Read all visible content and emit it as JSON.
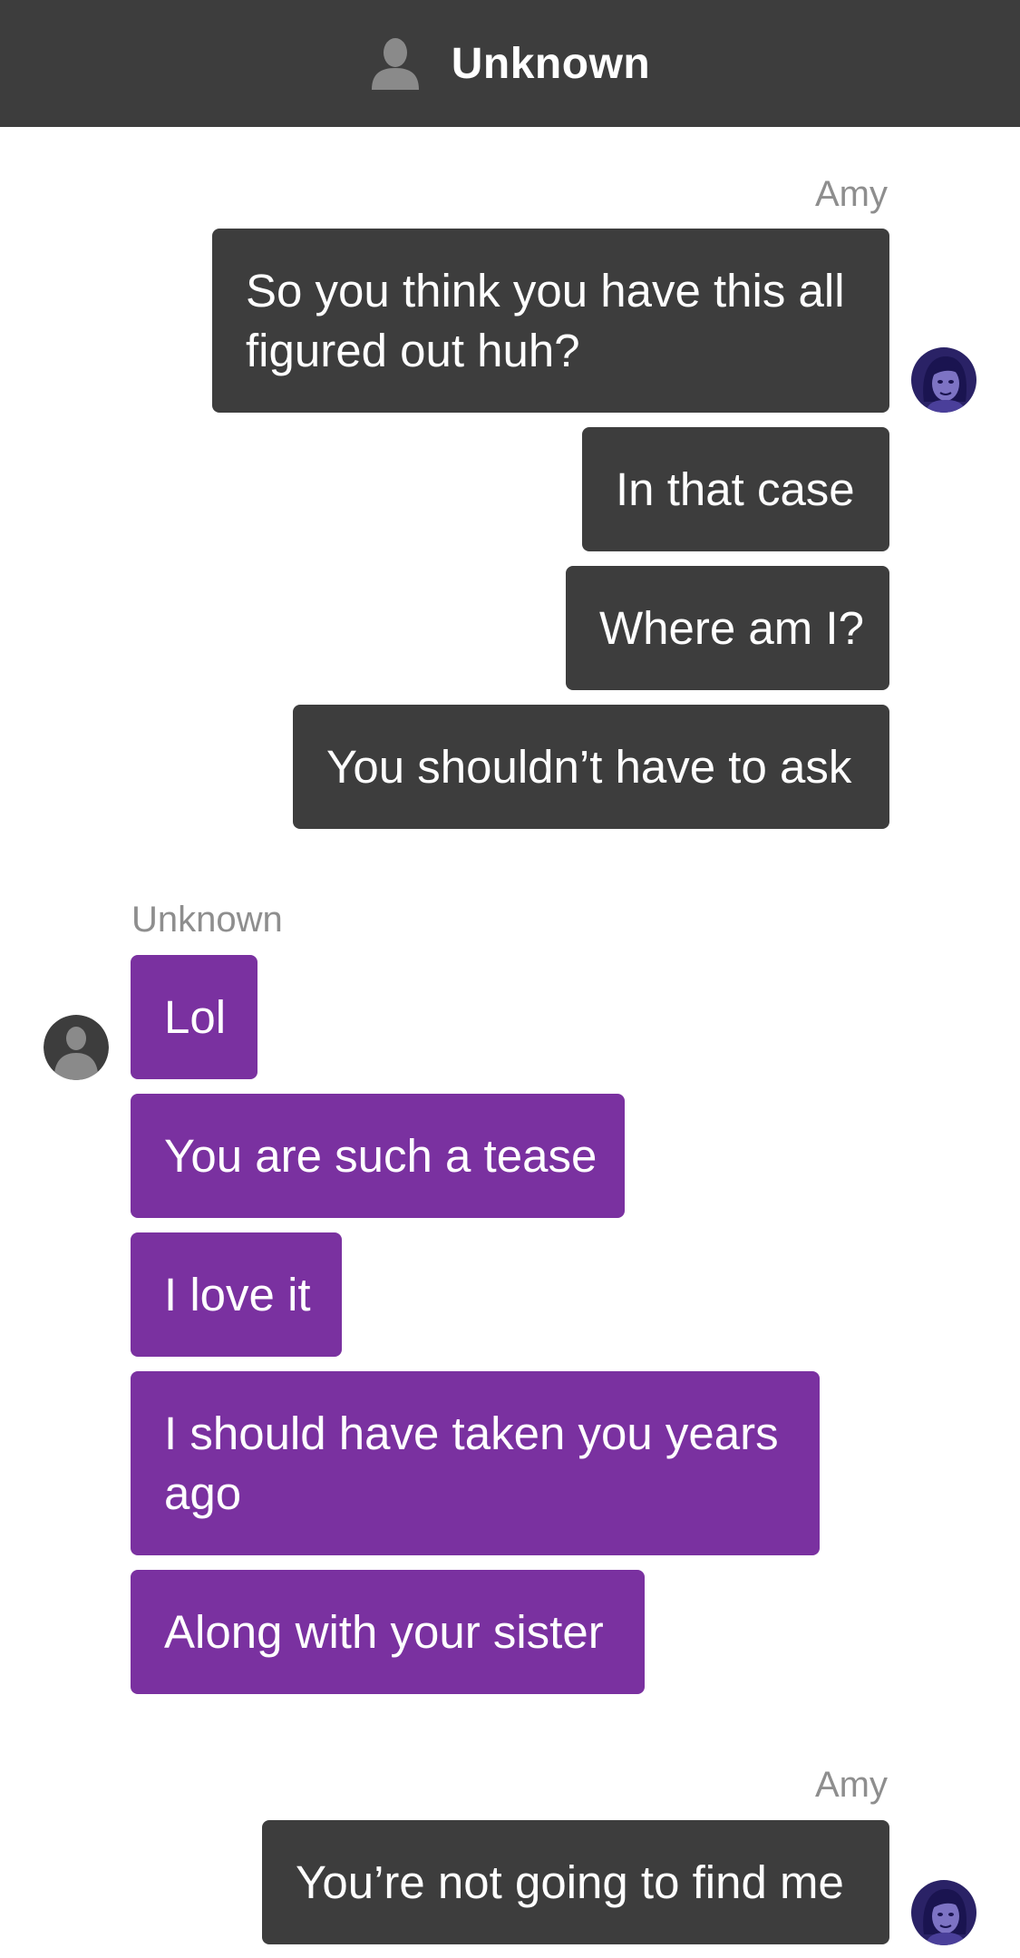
{
  "header": {
    "title": "Unknown",
    "avatar_icon": "person-silhouette-icon"
  },
  "conversation": {
    "groups": [
      {
        "sender": "Amy",
        "messages": [
          "So you think you have this all\nfigured out huh?",
          "In that case",
          "Where am I?",
          "You shouldn’t have to ask"
        ]
      },
      {
        "sender": "Unknown",
        "messages": [
          "Lol",
          "You are such a tease",
          "I love it",
          "I should have taken you years\nago",
          "Along with your sister"
        ]
      },
      {
        "sender": "Amy",
        "messages": [
          "You’re not going to find me"
        ]
      }
    ]
  },
  "colors": {
    "header_bg": "#3d3d3d",
    "outgoing_bubble": "#3d3d3d",
    "incoming_bubble": "#7a31a0",
    "sender_label": "#8e8e8e"
  }
}
